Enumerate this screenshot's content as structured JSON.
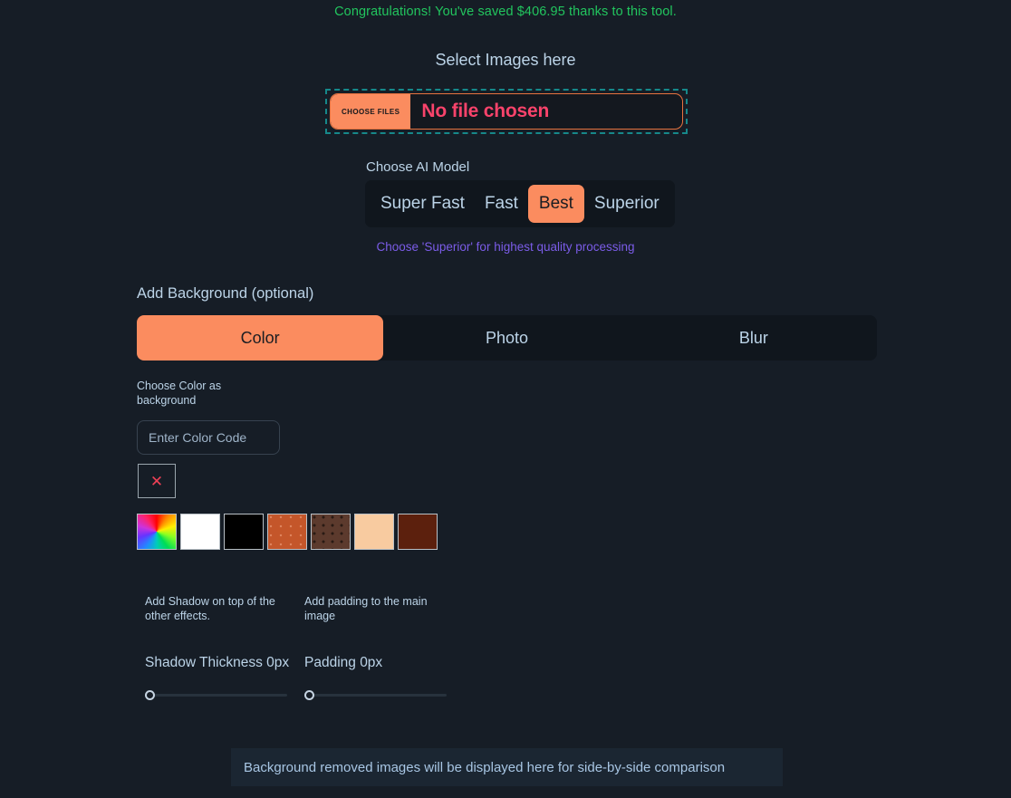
{
  "banner": {
    "congrats_text": "Congratulations! You've saved $406.95 thanks to this tool.",
    "congrats_color": "#22c55e"
  },
  "upload": {
    "heading": "Select Images here",
    "choose_files_label": "CHOOSE FILES",
    "file_status": "No file chosen",
    "dashed_border_color": "#16888a",
    "inner_border_color": "#e8733f",
    "status_color": "#f9436b"
  },
  "model": {
    "label": "Choose AI Model",
    "options": [
      {
        "label": "Super Fast",
        "selected": false
      },
      {
        "label": "Fast",
        "selected": false
      },
      {
        "label": "Best",
        "selected": true
      },
      {
        "label": "Superior",
        "selected": false
      }
    ],
    "hint": "Choose 'Superior' for highest quality processing",
    "hint_color": "#7b5ce8",
    "accent_color": "#fb8c5f"
  },
  "background": {
    "label": "Add Background (optional)",
    "tabs": [
      {
        "label": "Color",
        "selected": true
      },
      {
        "label": "Photo",
        "selected": false
      },
      {
        "label": "Blur",
        "selected": false
      }
    ]
  },
  "color_panel": {
    "caption": "Choose Color as background",
    "input_value": "",
    "input_placeholder": "Enter Color Code",
    "clear_label": "✕",
    "clear_color": "#ef4056",
    "swatches": [
      {
        "name": "rainbow-picker",
        "color": "rainbow"
      },
      {
        "name": "white",
        "color": "#ffffff"
      },
      {
        "name": "black",
        "color": "#000000"
      },
      {
        "name": "terracotta",
        "color": "#c4562a"
      },
      {
        "name": "brown",
        "color": "#5c3a2d"
      },
      {
        "name": "peach",
        "color": "#f8cba0"
      },
      {
        "name": "dark-red-brown",
        "color": "#5c200d"
      }
    ]
  },
  "shadow": {
    "caption": "Add Shadow on top of the other effects.",
    "value_label": "Shadow Thickness 0px",
    "value": 0,
    "min": 0,
    "max": 100
  },
  "padding": {
    "caption": "Add padding to the main image",
    "value_label": "Padding 0px",
    "value": 0,
    "min": 0,
    "max": 100
  },
  "result": {
    "placeholder_text": "Background removed images will be displayed here for side-by-side comparison"
  }
}
